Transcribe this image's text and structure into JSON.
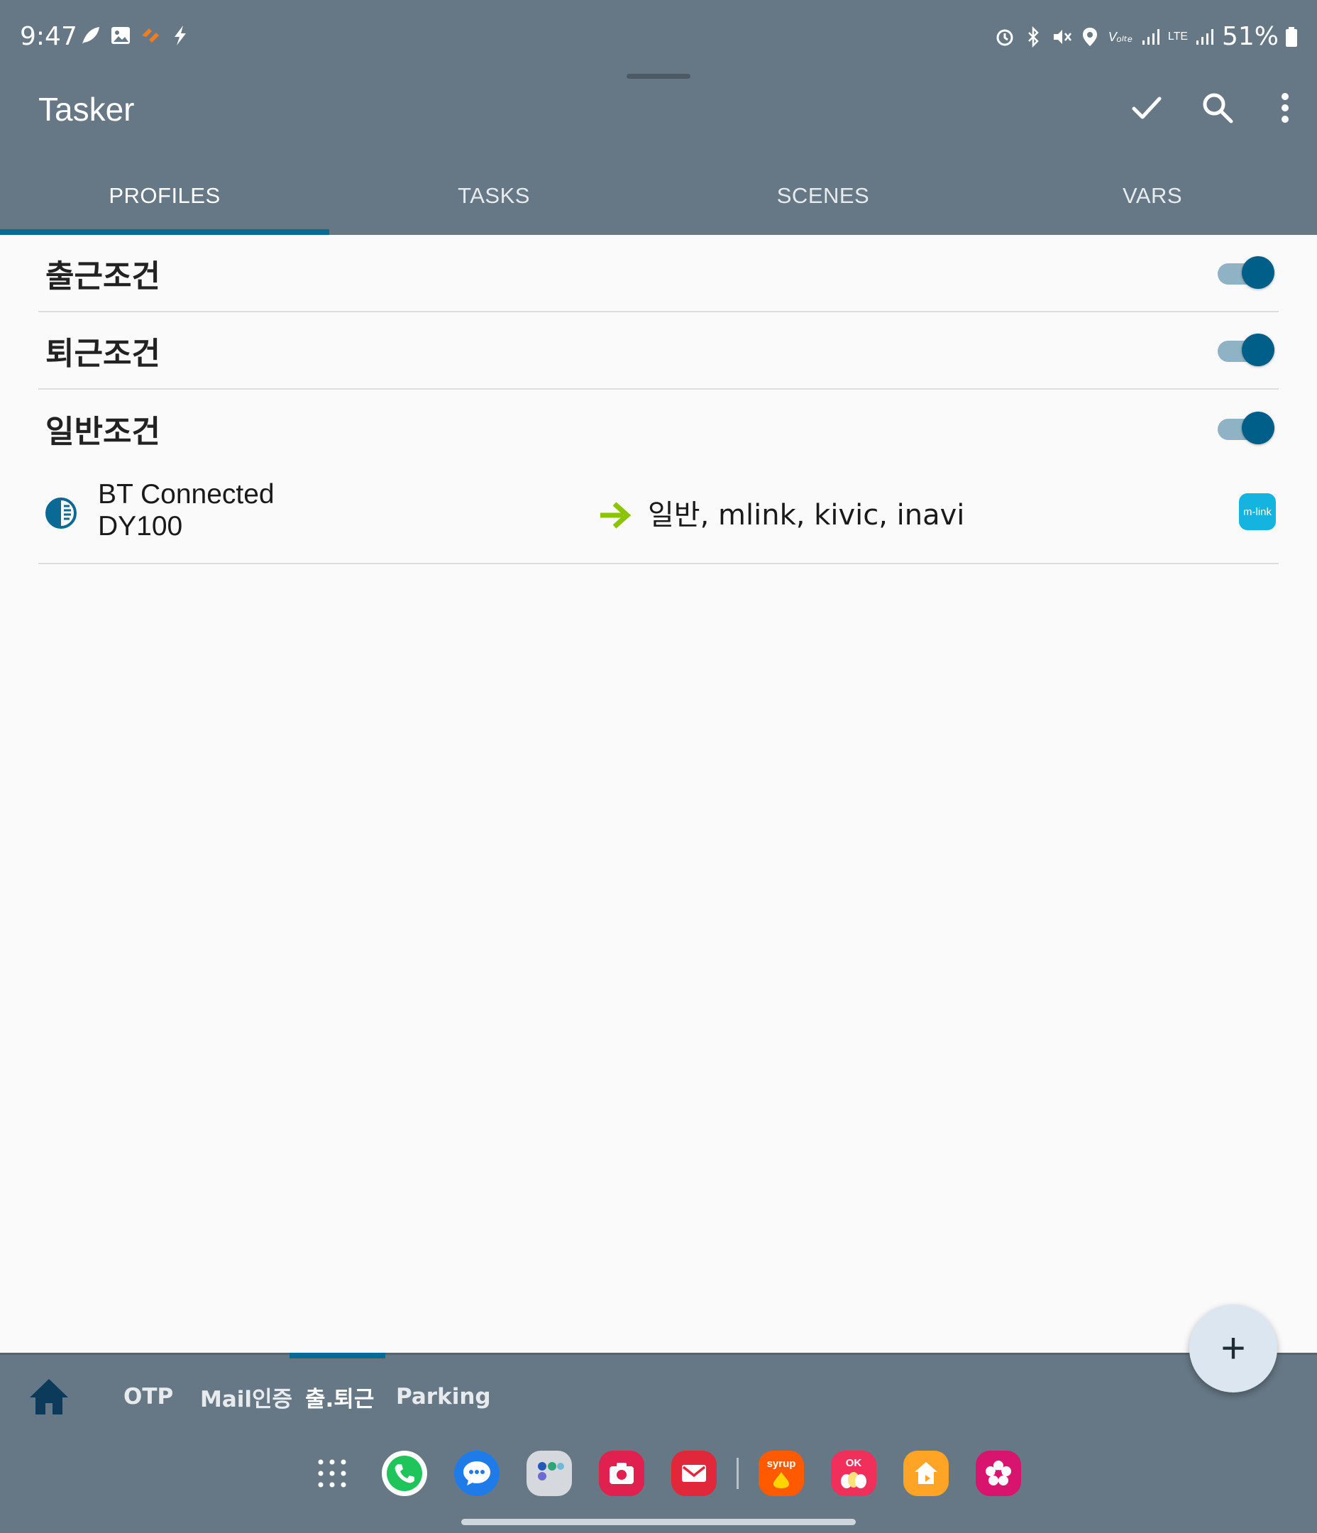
{
  "status_bar": {
    "time": "9:47",
    "battery": "51%",
    "left_icons": [
      "leaf-icon",
      "image-icon",
      "orange-app-icon",
      "bolt-icon"
    ],
    "right_icons": [
      "alarm-icon",
      "bluetooth-icon",
      "mute-icon",
      "location-icon",
      "volte-icon",
      "signal-icon",
      "lte-icon",
      "signal-icon",
      "battery-icon"
    ],
    "volte_label": "Vₒₗₜₑ",
    "lte_label": "LTE"
  },
  "app_bar": {
    "title": "Tasker",
    "actions": [
      "check-icon",
      "search-icon",
      "more-vert-icon"
    ]
  },
  "tabs": [
    {
      "label": "PROFILES",
      "active": true
    },
    {
      "label": "TASKS",
      "active": false
    },
    {
      "label": "SCENES",
      "active": false
    },
    {
      "label": "VARS",
      "active": false
    }
  ],
  "profiles": [
    {
      "name": "출근조건",
      "enabled": true
    },
    {
      "name": "퇴근조건",
      "enabled": true
    },
    {
      "name": "일반조건",
      "enabled": true
    }
  ],
  "expanded_profile": {
    "context_line1": "BT Connected",
    "context_line2": "DY100",
    "tasks": "일반, mlink, kivic, inavi",
    "task_icon_label": "m-link"
  },
  "fab": {
    "label": "+"
  },
  "bottom_tabs": [
    {
      "label": "OTP",
      "active": false
    },
    {
      "label": "Mail인증",
      "active": false
    },
    {
      "label": "출.퇴근",
      "active": true
    },
    {
      "label": "Parking",
      "active": false
    }
  ],
  "dock": {
    "syrup_label": "syrup",
    "ok_label": "OK"
  },
  "colors": {
    "bar_bg": "#667885",
    "accent": "#0a6a96",
    "toggle_on": "#005f88",
    "arrow_green": "#8bc400",
    "mlink": "#14b3e0"
  }
}
